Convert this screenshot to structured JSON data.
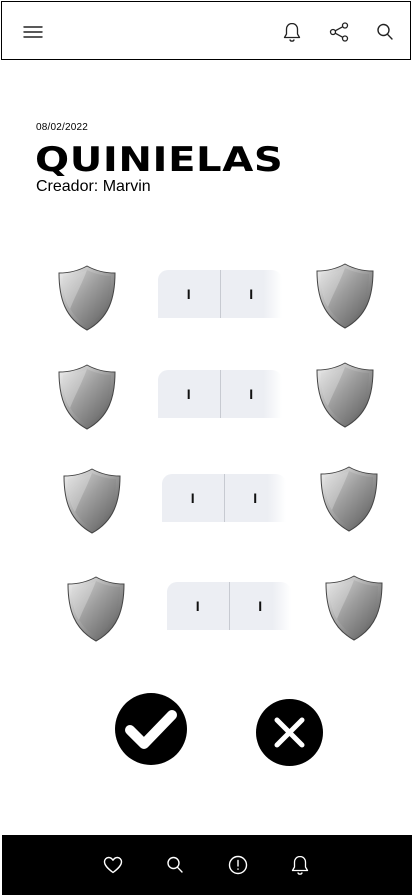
{
  "header": {
    "icons": [
      "menu-icon",
      "bell-icon",
      "share-icon",
      "search-icon"
    ]
  },
  "page": {
    "date": "08/02/2022",
    "title": "QUINIELAS",
    "creator": "Creador: Marvin"
  },
  "matches": [
    {
      "home_score": "I",
      "away_score": "I"
    },
    {
      "home_score": "I",
      "away_score": "I"
    },
    {
      "home_score": "I",
      "away_score": "I"
    },
    {
      "home_score": "I",
      "away_score": "I"
    }
  ],
  "actions": {
    "confirm": "check-icon",
    "cancel": "close-icon"
  },
  "bottom_nav": {
    "icons": [
      "heart-icon",
      "search-icon",
      "alert-icon",
      "bell-icon"
    ]
  },
  "colors": {
    "bar": "#000000",
    "score_bg": "#eceef3",
    "shield": "#9a9a9a"
  }
}
